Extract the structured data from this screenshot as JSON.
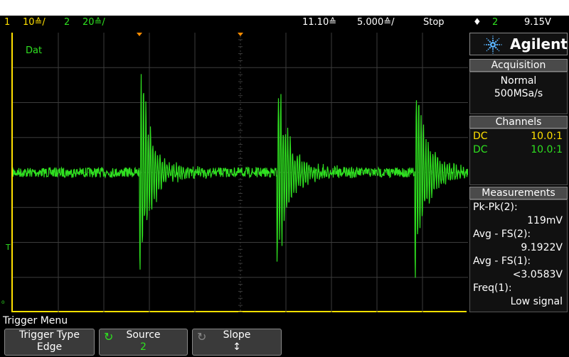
{
  "status_bar": {
    "ch1_num": "1",
    "ch1_scale": "10≙/",
    "ch2_num": "2",
    "ch2_scale": "20≙/",
    "time_offset": "11.10≙",
    "time_scale": "5.000≙/",
    "run_state": "Stop",
    "trigger_symbol": "♦",
    "trigger_ch": "2",
    "trigger_level": "9.15V"
  },
  "waveform": {
    "label": "Dat",
    "trigger_marker": "T",
    "ground_marker": "₀",
    "color": "#2fe020"
  },
  "panel": {
    "brand": "Agilent",
    "acquisition": {
      "title": "Acquisition",
      "mode": "Normal",
      "rate": "500MSa/s"
    },
    "channels": {
      "title": "Channels",
      "rows": [
        {
          "coupling": "DC",
          "probe": "10.0:1",
          "color": "#ffe000"
        },
        {
          "coupling": "DC",
          "probe": "10.0:1",
          "color": "#2fe020"
        }
      ]
    },
    "measurements": {
      "title": "Measurements",
      "items": [
        {
          "name": "Pk-Pk(2):",
          "value": "119mV"
        },
        {
          "name": "Avg - FS(2):",
          "value": "9.1922V"
        },
        {
          "name": "Avg - FS(1):",
          "value": "<3.0583V"
        },
        {
          "name": "Freq(1):",
          "value": "Low signal"
        }
      ]
    }
  },
  "menu": {
    "title": "Trigger Menu",
    "softkeys": [
      {
        "label": "Trigger Type",
        "value": "Edge"
      },
      {
        "label": "Source",
        "value": "2"
      },
      {
        "label": "Slope",
        "value": "↕"
      }
    ]
  }
}
